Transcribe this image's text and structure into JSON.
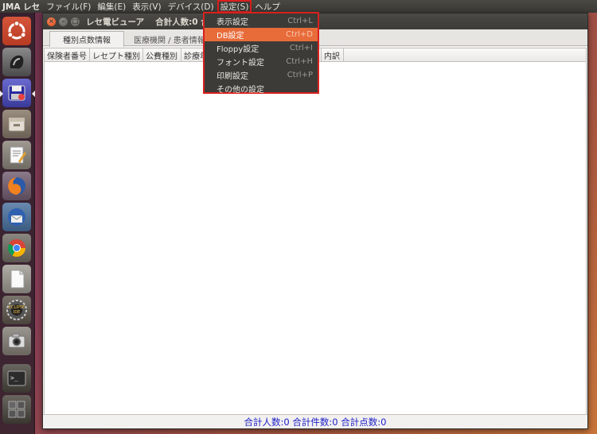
{
  "topbar": {
    "app_title": "JMA レセ",
    "menus": [
      "ファイル(F)",
      "編集(E)",
      "表示(V)",
      "デバイス(D)",
      "設定(S)",
      "ヘルプ"
    ]
  },
  "launcher": {
    "icons": [
      "ubuntu-dash-icon",
      "jma-receipt-icon",
      "disk-save-icon",
      "file-manager-icon",
      "text-editor-icon",
      "firefox-icon",
      "thunderbird-icon",
      "chrome-icon",
      "document-icon",
      "geany-ide-icon",
      "camera-icon",
      "terminal-icon",
      "workspace-switcher-icon"
    ]
  },
  "window": {
    "title": "レセ電ビューア",
    "title_count": "合計人数:0 合計",
    "tabs": [
      "種別点数情報",
      "医療機関 / 患者情報"
    ],
    "columns": [
      "保険者番号",
      "レセプト種別",
      "公費種別",
      "診療年",
      "内訳"
    ],
    "status": "合計人数:0 合計件数:0 合計点数:0"
  },
  "dropdown": {
    "items": [
      {
        "label": "表示設定",
        "shortcut": "Ctrl+L"
      },
      {
        "label": "DB設定",
        "shortcut": "Ctrl+D"
      },
      {
        "label": "Floppy設定",
        "shortcut": "Ctrl+I"
      },
      {
        "label": "フォント設定",
        "shortcut": "Ctrl+H"
      },
      {
        "label": "印刷設定",
        "shortcut": "Ctrl+P"
      },
      {
        "label": "その他の設定",
        "shortcut": ""
      }
    ]
  },
  "colors": {
    "highlight": "#e86b3a",
    "callout": "#d8201e",
    "status_text": "#2020c8"
  }
}
